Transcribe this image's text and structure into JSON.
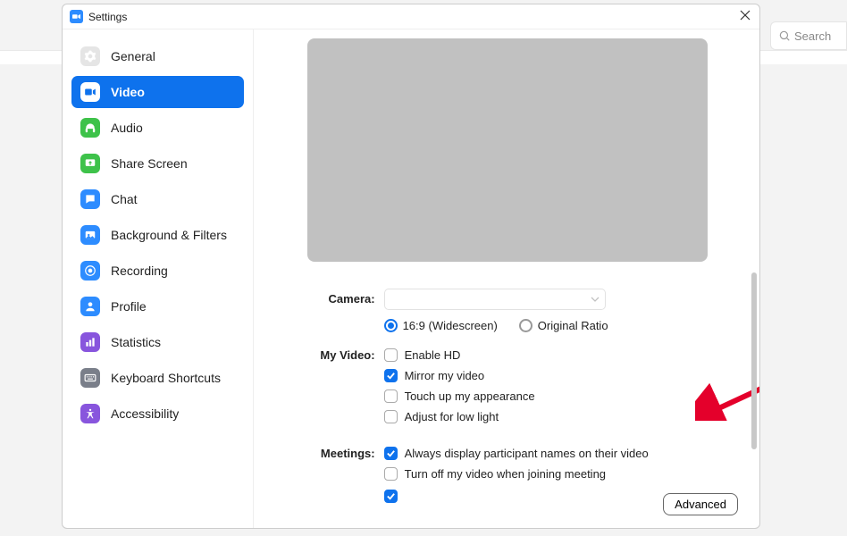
{
  "window": {
    "title": "Settings"
  },
  "search": {
    "placeholder": "Search"
  },
  "sidebar": {
    "items": [
      {
        "label": "General",
        "active": false,
        "iconBg": "#e5e5e5",
        "iconFg": "#ffffff",
        "icon": "gear"
      },
      {
        "label": "Video",
        "active": true,
        "iconBg": "#ffffff",
        "iconFg": "#2d8cff",
        "icon": "video"
      },
      {
        "label": "Audio",
        "active": false,
        "iconBg": "#3ec24a",
        "iconFg": "#ffffff",
        "icon": "headphones"
      },
      {
        "label": "Share Screen",
        "active": false,
        "iconBg": "#3ec24a",
        "iconFg": "#ffffff",
        "icon": "share"
      },
      {
        "label": "Chat",
        "active": false,
        "iconBg": "#2d8cff",
        "iconFg": "#ffffff",
        "icon": "chat"
      },
      {
        "label": "Background & Filters",
        "active": false,
        "iconBg": "#2d8cff",
        "iconFg": "#ffffff",
        "icon": "bgfilters"
      },
      {
        "label": "Recording",
        "active": false,
        "iconBg": "#2d8cff",
        "iconFg": "#ffffff",
        "icon": "record"
      },
      {
        "label": "Profile",
        "active": false,
        "iconBg": "#2d8cff",
        "iconFg": "#ffffff",
        "icon": "profile"
      },
      {
        "label": "Statistics",
        "active": false,
        "iconBg": "#8855dd",
        "iconFg": "#ffffff",
        "icon": "stats"
      },
      {
        "label": "Keyboard Shortcuts",
        "active": false,
        "iconBg": "#7a7f8a",
        "iconFg": "#ffffff",
        "icon": "keyboard"
      },
      {
        "label": "Accessibility",
        "active": false,
        "iconBg": "#8855dd",
        "iconFg": "#ffffff",
        "icon": "accessibility"
      }
    ]
  },
  "settings": {
    "camera": {
      "label": "Camera:",
      "selected": ""
    },
    "ratio": {
      "widescreen": {
        "label": "16:9 (Widescreen)",
        "checked": true
      },
      "original": {
        "label": "Original Ratio",
        "checked": false
      }
    },
    "myVideo": {
      "label": "My Video:",
      "enableHd": {
        "label": "Enable HD",
        "checked": false
      },
      "mirror": {
        "label": "Mirror my video",
        "checked": true
      },
      "touchUp": {
        "label": "Touch up my appearance",
        "checked": false
      },
      "lowLight": {
        "label": "Adjust for low light",
        "checked": false
      }
    },
    "meetings": {
      "label": "Meetings:",
      "showNames": {
        "label": "Always display participant names on their video",
        "checked": true
      },
      "turnOff": {
        "label": "Turn off my video when joining meeting",
        "checked": false
      },
      "hiddenCut": {
        "checked": true
      }
    },
    "advanced": "Advanced"
  }
}
